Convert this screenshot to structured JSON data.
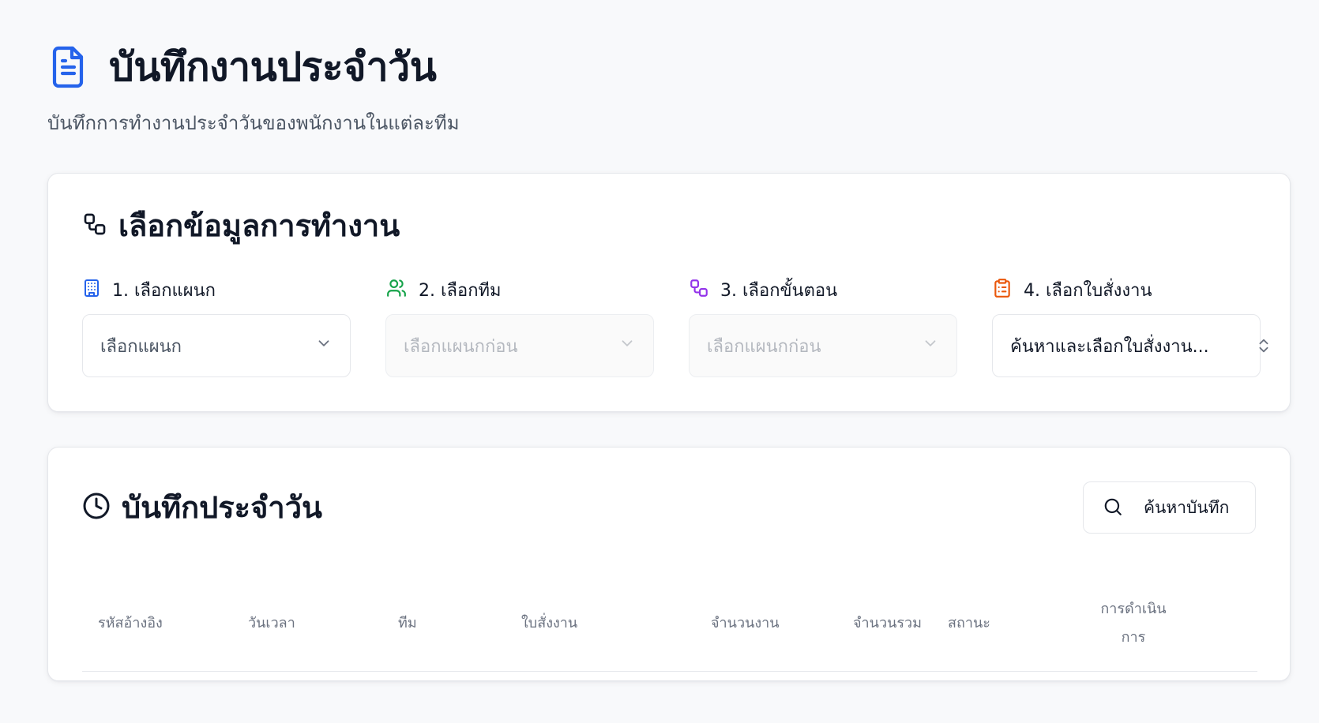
{
  "header": {
    "title": "บันทึกงานประจำวัน",
    "subtitle": "บันทึกการทำงานประจำวันของพนักงานในแต่ละทีม",
    "icon": "document-icon"
  },
  "selection_card": {
    "title": "เลือกข้อมูลการทำงาน",
    "icon": "workflow-icon",
    "fields": [
      {
        "label": "1. เลือกแผนก",
        "icon": "building-icon",
        "icon_color": "#2563eb",
        "value": "เลือกแผนก",
        "disabled": false
      },
      {
        "label": "2. เลือกทีม",
        "icon": "users-icon",
        "icon_color": "#16a34a",
        "value": "เลือกแผนกก่อน",
        "disabled": true
      },
      {
        "label": "3. เลือกขั้นตอน",
        "icon": "workflow-icon",
        "icon_color": "#9333ea",
        "value": "เลือกแผนกก่อน",
        "disabled": true
      },
      {
        "label": "4. เลือกใบสั่งงาน",
        "icon": "clipboard-icon",
        "icon_color": "#ea580c",
        "value": "ค้นหาและเลือกใบสั่งงาน...",
        "disabled": false
      }
    ]
  },
  "log_card": {
    "title": "บันทึกประจำวัน",
    "icon": "clock-icon",
    "search_button": "ค้นหาบันทึก",
    "columns": [
      "รหัสอ้างอิง",
      "วันเวลา",
      "ทีม",
      "ใบสั่งงาน",
      "จำนวนงาน",
      "จำนวนรวม",
      "สถานะ",
      "การดำเนินการ"
    ],
    "rows": []
  }
}
